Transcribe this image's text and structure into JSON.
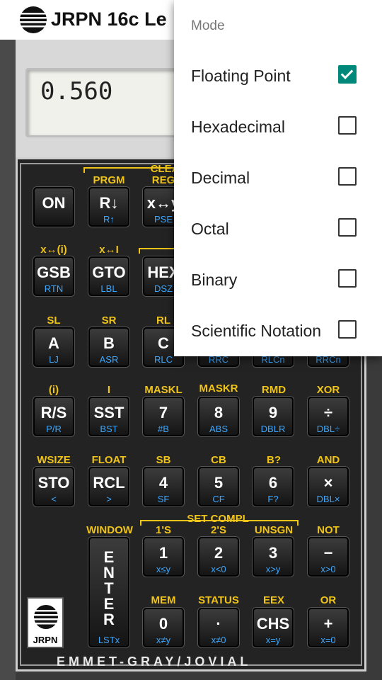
{
  "app": {
    "title": "JRPN 16c Le"
  },
  "display": {
    "value": "0.560"
  },
  "menu": {
    "header": "Mode",
    "items": [
      {
        "label": "Floating Point",
        "checked": true
      },
      {
        "label": "Hexadecimal",
        "checked": false
      },
      {
        "label": "Decimal",
        "checked": false
      },
      {
        "label": "Octal",
        "checked": false
      },
      {
        "label": "Binary",
        "checked": false
      },
      {
        "label": "Scientific Notation",
        "checked": false
      }
    ]
  },
  "gold_labels": {
    "clear": "CLEA",
    "set_compl": "SET COMPL",
    "prgm": "PRGM",
    "reg": "REG",
    "xi": "x↔(i)",
    "xl": "x↔I",
    "sl": "SL",
    "sr": "SR",
    "rl": "RL",
    "i_paren": "(i)",
    "i": "I",
    "maskl": "MASKL",
    "maskr": "MASKR",
    "rmd": "RMD",
    "xor": "XOR",
    "wsize": "WSIZE",
    "float": "FLOAT",
    "sb": "SB",
    "cb": "CB",
    "bq": "B?",
    "and": "AND",
    "window": "WINDOW",
    "ones": "1'S",
    "twos": "2'S",
    "unsgn": "UNSGN",
    "not": "NOT",
    "mem": "MEM",
    "status": "STATUS",
    "eex": "EEX",
    "or": "OR"
  },
  "keys": {
    "on": {
      "main": "ON",
      "blue": ""
    },
    "rdown": {
      "main": "R↓",
      "blue": "R↑"
    },
    "xy": {
      "main": "x↔y",
      "blue": "PSE"
    },
    "gsb": {
      "main": "GSB",
      "blue": "RTN"
    },
    "gto": {
      "main": "GTO",
      "blue": "LBL"
    },
    "hex": {
      "main": "HEX",
      "blue": "DSZ"
    },
    "a": {
      "main": "A",
      "blue": "LJ"
    },
    "b": {
      "main": "B",
      "blue": "ASR"
    },
    "c": {
      "main": "C",
      "blue": "RLC"
    },
    "d_partial": {
      "blue": "RRC"
    },
    "e_partial": {
      "blue": "RLCn"
    },
    "f_partial": {
      "blue": "RRCn"
    },
    "rs": {
      "main": "R/S",
      "blue": "P/R"
    },
    "sst": {
      "main": "SST",
      "blue": "BST"
    },
    "k7": {
      "main": "7",
      "blue": "#B"
    },
    "k8": {
      "main": "8",
      "blue": "ABS"
    },
    "k9": {
      "main": "9",
      "blue": "DBLR"
    },
    "div": {
      "main": "÷",
      "blue": "DBL÷"
    },
    "sto": {
      "main": "STO",
      "blue": "<"
    },
    "rcl": {
      "main": "RCL",
      "blue": ">"
    },
    "k4": {
      "main": "4",
      "blue": "SF"
    },
    "k5": {
      "main": "5",
      "blue": "CF"
    },
    "k6": {
      "main": "6",
      "blue": "F?"
    },
    "mul": {
      "main": "×",
      "blue": "DBL×"
    },
    "enter": {
      "main": "E N T E R",
      "blue": "LSTx"
    },
    "k1": {
      "main": "1",
      "blue": "x≤y"
    },
    "k2": {
      "main": "2",
      "blue": "x<0"
    },
    "k3": {
      "main": "3",
      "blue": "x>y"
    },
    "sub": {
      "main": "−",
      "blue": "x>0"
    },
    "k0": {
      "main": "0",
      "blue": "x≠y"
    },
    "dot": {
      "main": "·",
      "blue": "x≠0"
    },
    "chs": {
      "main": "CHS",
      "blue": "x=y"
    },
    "add": {
      "main": "+",
      "blue": "x=0"
    }
  },
  "branding": {
    "name": "EMMET-GRAY/JOVIAL",
    "badge": "JRPN"
  },
  "colors": {
    "accent": "#00897b",
    "gold": "#f0c419",
    "blue": "#3da7ff"
  }
}
